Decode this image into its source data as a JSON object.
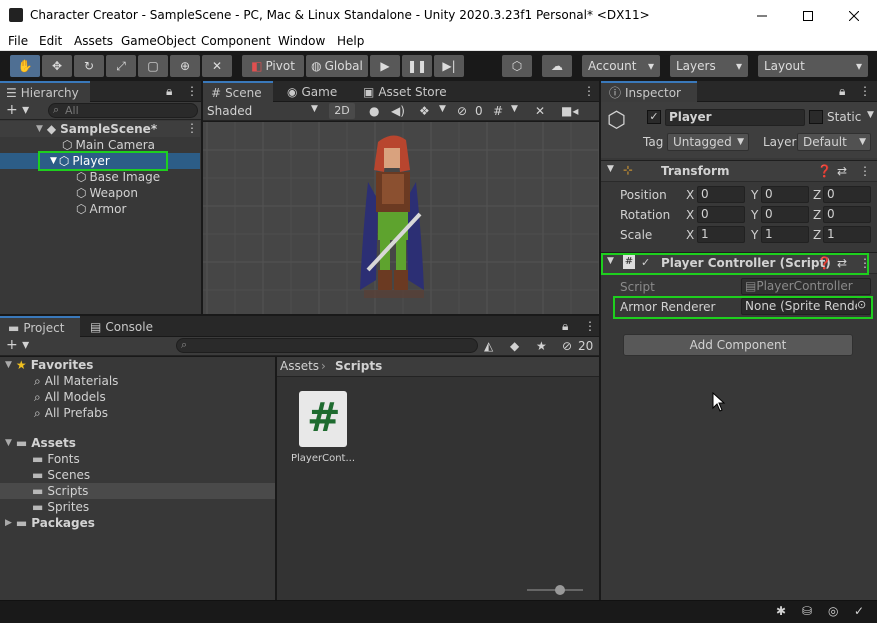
{
  "window": {
    "title": "Character Creator - SampleScene - PC, Mac & Linux Standalone - Unity 2020.3.23f1 Personal* <DX11>"
  },
  "menu": [
    "File",
    "Edit",
    "Assets",
    "GameObject",
    "Component",
    "Window",
    "Help"
  ],
  "toolbar": {
    "pivot": "Pivot",
    "global": "Global",
    "account": "Account",
    "layers": "Layers",
    "layout": "Layout"
  },
  "hierarchy": {
    "tab": "Hierarchy",
    "search_placeholder": "All",
    "scene": "SampleScene*",
    "items": [
      "Main Camera",
      "Player",
      "Base Image",
      "Weapon",
      "Armor"
    ]
  },
  "scene_view": {
    "tabs": [
      "Scene",
      "Game",
      "Asset Store"
    ],
    "shading": "Shaded",
    "mode2d": "2D",
    "hidden_count": "0"
  },
  "project": {
    "tabs": [
      "Project",
      "Console"
    ],
    "hidden_count": "20",
    "favorites": {
      "label": "Favorites",
      "items": [
        "All Materials",
        "All Models",
        "All Prefabs"
      ]
    },
    "assets": {
      "label": "Assets",
      "items": [
        "Fonts",
        "Scenes",
        "Scripts",
        "Sprites"
      ]
    },
    "packages": "Packages",
    "breadcrumb": [
      "Assets",
      "Scripts"
    ],
    "files": [
      {
        "name": "PlayerCont...",
        "icon": "#"
      }
    ]
  },
  "inspector": {
    "tab": "Inspector",
    "object_name": "Player",
    "static_label": "Static",
    "tag_label": "Tag",
    "tag_value": "Untagged",
    "layer_label": "Layer",
    "layer_value": "Default",
    "transform": {
      "title": "Transform",
      "rows": [
        {
          "label": "Position",
          "x": "0",
          "y": "0",
          "z": "0"
        },
        {
          "label": "Rotation",
          "x": "0",
          "y": "0",
          "z": "0"
        },
        {
          "label": "Scale",
          "x": "1",
          "y": "1",
          "z": "1"
        }
      ],
      "axes": [
        "X",
        "Y",
        "Z"
      ]
    },
    "player_controller": {
      "title": "Player Controller (Script)",
      "script_label": "Script",
      "script_value": "PlayerController",
      "armor_label": "Armor Renderer",
      "armor_value": "None (Sprite Rende"
    },
    "add_component": "Add Component"
  },
  "colors": {
    "highlight": "#1ecf1e",
    "selection": "#2c5d87",
    "accent": "#3a79bb"
  }
}
